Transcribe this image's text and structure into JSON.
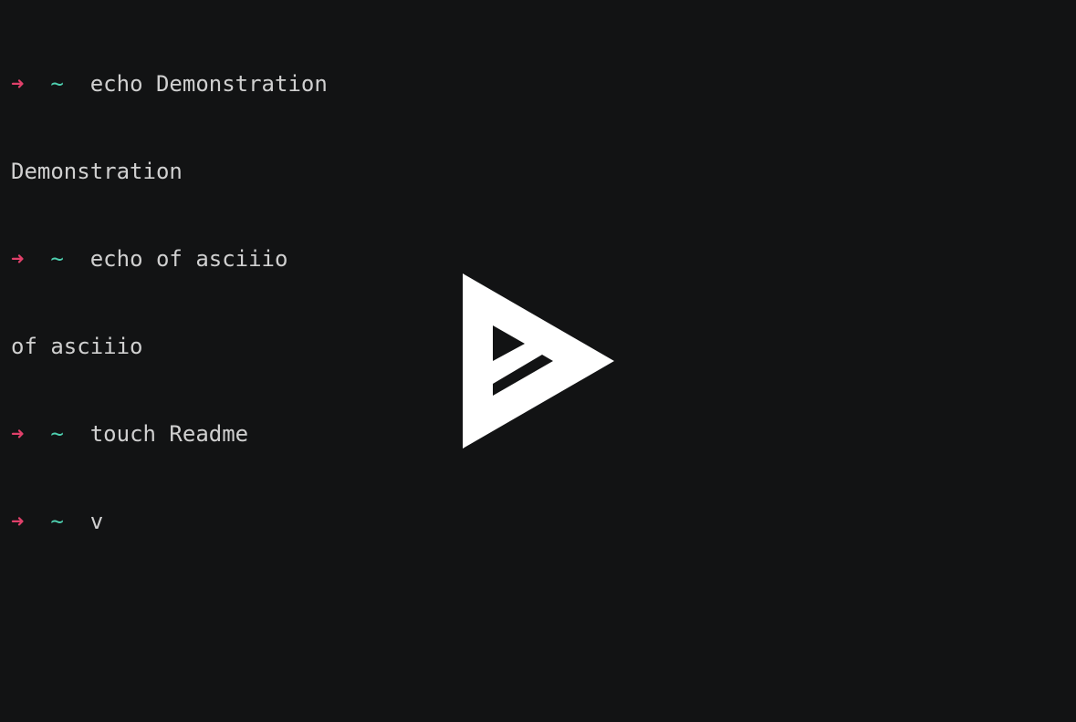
{
  "terminal": {
    "prompt_arrow": "➜",
    "prompt_dir": "~",
    "lines": [
      {
        "type": "prompt",
        "command": "echo Demonstration"
      },
      {
        "type": "output",
        "text": "Demonstration"
      },
      {
        "type": "prompt",
        "command": "echo of asciiio"
      },
      {
        "type": "output",
        "text": "of asciiio"
      },
      {
        "type": "prompt",
        "command": "touch Readme"
      },
      {
        "type": "prompt",
        "command": "v"
      }
    ]
  },
  "colors": {
    "background": "#121314",
    "text": "#d0d0d0",
    "prompt_arrow": "#e0406a",
    "prompt_dir": "#4ed0b0",
    "play_icon": "#ffffff"
  },
  "overlay": {
    "icon": "asciinema-play-icon"
  }
}
